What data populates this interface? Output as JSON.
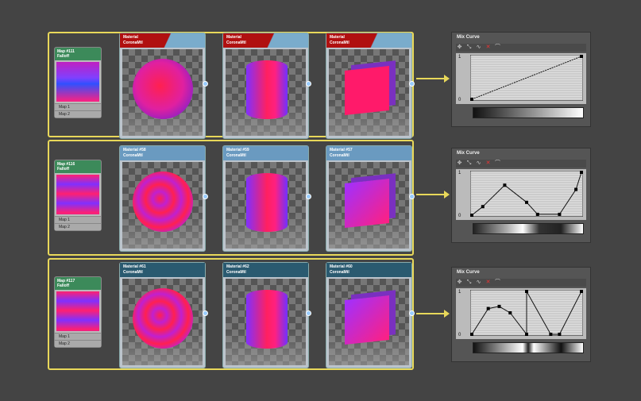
{
  "rows": [
    {
      "map": {
        "title": "Map #111",
        "type": "Falloff",
        "slots": [
          "Map 1",
          "Map 2"
        ]
      },
      "header_color": "#b01010",
      "materials": [
        {
          "name": "Material",
          "type": "CoronaMtl"
        },
        {
          "name": "Material",
          "type": "CoronaMtl"
        },
        {
          "name": "Material",
          "type": "CoronaMtl"
        }
      ],
      "curve": {
        "title": "Mix Curve",
        "y_top": "1",
        "y_bottom": "0",
        "points": [
          [
            0,
            0
          ],
          [
            1,
            1
          ]
        ],
        "gradient": "linear-gradient(90deg,#111,#fff)"
      }
    },
    {
      "map": {
        "title": "Map #116",
        "type": "Falloff",
        "slots": [
          "Map 1",
          "Map 2"
        ]
      },
      "header_color": "#6a9ac0",
      "materials": [
        {
          "name": "Material #58",
          "type": "CoronaMtl"
        },
        {
          "name": "Material #59",
          "type": "CoronaMtl"
        },
        {
          "name": "Material #57",
          "type": "CoronaMtl"
        }
      ],
      "curve": {
        "title": "Mix Curve",
        "y_top": "1",
        "y_bottom": "0",
        "points": [
          [
            0,
            0
          ],
          [
            0.1,
            0.2
          ],
          [
            0.3,
            0.7
          ],
          [
            0.5,
            0.3
          ],
          [
            0.6,
            0.02
          ],
          [
            0.8,
            0.02
          ],
          [
            0.95,
            0.6
          ],
          [
            1,
            1
          ]
        ],
        "gradient": "linear-gradient(90deg,#222,#aaa 30%,#fff 45%,#333 60%,#222 80%,#fff)"
      }
    },
    {
      "map": {
        "title": "Map #117",
        "type": "Falloff",
        "slots": [
          "Map 1",
          "Map 2"
        ]
      },
      "header_color": "#2a5a70",
      "materials": [
        {
          "name": "Material #61",
          "type": "CoronaMtl"
        },
        {
          "name": "Material #62",
          "type": "CoronaMtl"
        },
        {
          "name": "Material #60",
          "type": "CoronaMtl"
        }
      ],
      "curve": {
        "title": "Mix Curve",
        "y_top": "1",
        "y_bottom": "0",
        "points": [
          [
            0,
            0
          ],
          [
            0.15,
            0.6
          ],
          [
            0.25,
            0.65
          ],
          [
            0.35,
            0.5
          ],
          [
            0.5,
            0
          ],
          [
            0.5,
            1
          ],
          [
            0.72,
            0
          ],
          [
            0.8,
            0
          ],
          [
            1,
            1
          ]
        ],
        "gradient": "linear-gradient(90deg,#111,#fff 45%,#222 50%,#fff 55%,#111 80%,#fff)"
      }
    }
  ]
}
